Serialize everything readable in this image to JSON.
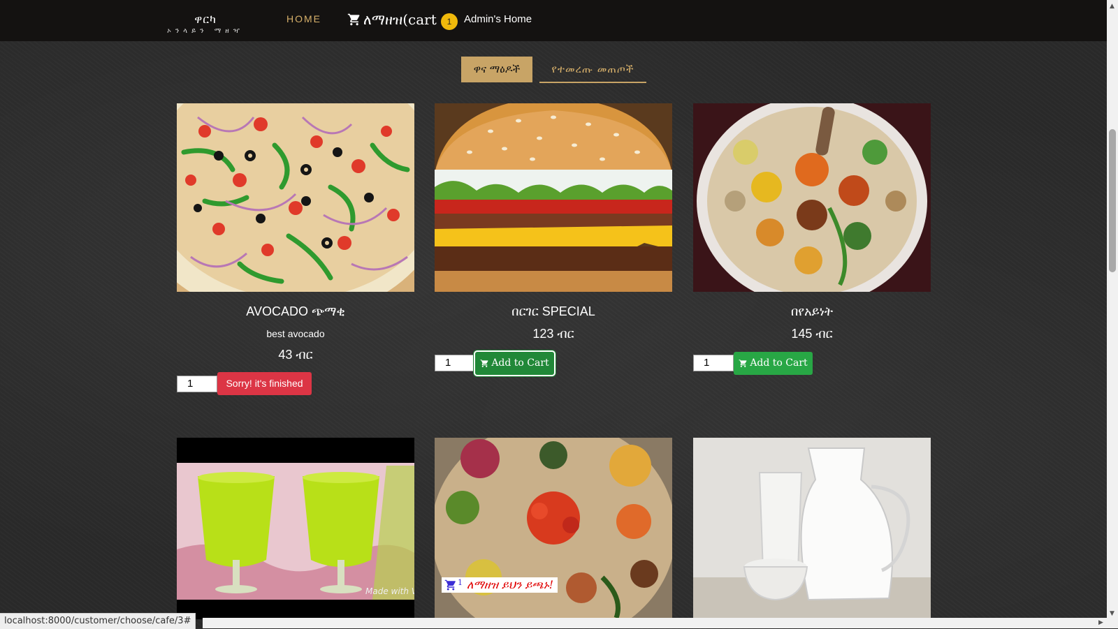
{
  "nav": {
    "brand_main": "ዋርካ",
    "brand_sub": "ኦንላይን ማዘዣ",
    "home": "HOME",
    "cart_label": "ለማዘዝ(cart",
    "cart_count": "1",
    "admin": "Admin's Home"
  },
  "tabs": {
    "active": "ዋና ማዕዶች",
    "other": "የተመረጡ መጠጦች"
  },
  "products": [
    {
      "name": "AVOCADO ጭማቂ",
      "description": "best avocado",
      "price": "43 ብር",
      "qty": "1",
      "button": "Sorry! it's finished",
      "image": "pizza"
    },
    {
      "name": "በርገር SPECIAL",
      "price": "123 ብር",
      "qty": "1",
      "button": "Add to Cart",
      "image": "burger"
    },
    {
      "name": "በየአይነት",
      "price": "145 ብር",
      "qty": "1",
      "button": "Add to Cart",
      "image": "injera-platter"
    },
    {
      "image": "green-juice",
      "watermark": "Made with VideoShow"
    },
    {
      "image": "injera-feast",
      "overlay_count": "1",
      "overlay_text": "ለማዘዝ ይህን ይጫኑ!"
    },
    {
      "image": "milk-jug"
    }
  ],
  "status_url": "localhost:8000/customer/choose/cafe/3#",
  "icons": [
    "cart-icon"
  ],
  "colors": {
    "accent": "#c8a466",
    "add": "#28a745",
    "finished": "#dc3545",
    "badge": "#f0b90b"
  }
}
